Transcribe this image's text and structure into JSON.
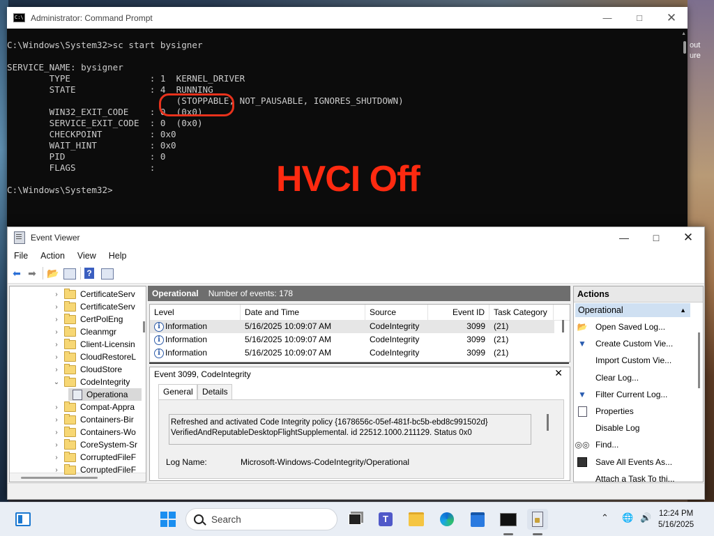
{
  "cmd": {
    "title": "Administrator: Command Prompt",
    "lines": [
      "",
      "C:\\Windows\\System32>sc start bysigner",
      "",
      "SERVICE_NAME: bysigner",
      "        TYPE               : 1  KERNEL_DRIVER",
      "        STATE              : 4  RUNNING",
      "                                (STOPPABLE, NOT_PAUSABLE, IGNORES_SHUTDOWN)",
      "        WIN32_EXIT_CODE    : 0  (0x0)",
      "        SERVICE_EXIT_CODE  : 0  (0x0)",
      "        CHECKPOINT         : 0x0",
      "        WAIT_HINT          : 0x0",
      "        PID                : 0",
      "        FLAGS              :",
      "",
      "C:\\Windows\\System32>"
    ],
    "annotation": "HVCI Off",
    "annotation_color": "#ff2a10"
  },
  "wallpaper_text": [
    "out",
    "ure"
  ],
  "event_viewer": {
    "title": "Event Viewer",
    "menu": [
      "File",
      "Action",
      "View",
      "Help"
    ],
    "tree": [
      {
        "label": "CertificateServ",
        "type": "folder",
        "chevron": "›"
      },
      {
        "label": "CertificateServ",
        "type": "folder",
        "chevron": "›"
      },
      {
        "label": "CertPolEng",
        "type": "folder",
        "chevron": "›"
      },
      {
        "label": "Cleanmgr",
        "type": "folder",
        "chevron": "›"
      },
      {
        "label": "Client-Licensin",
        "type": "folder",
        "chevron": "›"
      },
      {
        "label": "CloudRestoreL",
        "type": "folder",
        "chevron": "›"
      },
      {
        "label": "CloudStore",
        "type": "folder",
        "chevron": "›"
      },
      {
        "label": "CodeIntegrity",
        "type": "folder",
        "chevron": "⌄"
      },
      {
        "label": "Operationa",
        "type": "log",
        "chevron": ""
      },
      {
        "label": "Compat-Appra",
        "type": "folder",
        "chevron": "›"
      },
      {
        "label": "Containers-Bir",
        "type": "folder",
        "chevron": "›"
      },
      {
        "label": "Containers-Wo",
        "type": "folder",
        "chevron": "›"
      },
      {
        "label": "CoreSystem-Sr",
        "type": "folder",
        "chevron": "›"
      },
      {
        "label": "CorruptedFileF",
        "type": "folder",
        "chevron": "›"
      },
      {
        "label": "CorruptedFileF",
        "type": "folder",
        "chevron": "›"
      }
    ],
    "log_header": {
      "name": "Operational",
      "count": "Number of events: 178"
    },
    "columns": [
      "Level",
      "Date and Time",
      "Source",
      "Event ID",
      "Task Category"
    ],
    "rows": [
      {
        "level": "Information",
        "datetime": "5/16/2025 10:09:07 AM",
        "source": "CodeIntegrity",
        "event_id": "3099",
        "task": "(21)"
      },
      {
        "level": "Information",
        "datetime": "5/16/2025 10:09:07 AM",
        "source": "CodeIntegrity",
        "event_id": "3099",
        "task": "(21)"
      },
      {
        "level": "Information",
        "datetime": "5/16/2025 10:09:07 AM",
        "source": "CodeIntegrity",
        "event_id": "3099",
        "task": "(21)"
      }
    ],
    "detail": {
      "title": "Event 3099, CodeIntegrity",
      "tabs": [
        "General",
        "Details"
      ],
      "description_line1": "Refreshed and activated Code Integrity policy {1678656c-05ef-481f-bc5b-ebd8c991502d}",
      "description_line2": "VerifiedAndReputableDesktopFlightSupplemental. id 22512.1000.211129. Status 0x0",
      "log_name_label": "Log Name:",
      "log_name_value": "Microsoft-Windows-CodeIntegrity/Operational"
    },
    "actions": {
      "header": "Actions",
      "section": "Operational",
      "items": [
        {
          "label": "Open Saved Log...",
          "icon": "open-log-icon"
        },
        {
          "label": "Create Custom Vie...",
          "icon": "filter-icon"
        },
        {
          "label": "Import Custom Vie...",
          "icon": ""
        },
        {
          "label": "Clear Log...",
          "icon": ""
        },
        {
          "label": "Filter Current Log...",
          "icon": "filter-icon"
        },
        {
          "label": "Properties",
          "icon": "properties-icon"
        },
        {
          "label": "Disable Log",
          "icon": ""
        },
        {
          "label": "Find...",
          "icon": "binoculars-icon"
        },
        {
          "label": "Save All Events As...",
          "icon": "save-icon"
        },
        {
          "label": "Attach a Task To thi...",
          "icon": ""
        }
      ]
    }
  },
  "taskbar": {
    "search_placeholder": "Search",
    "time": "12:24 PM",
    "date": "5/16/2025"
  }
}
